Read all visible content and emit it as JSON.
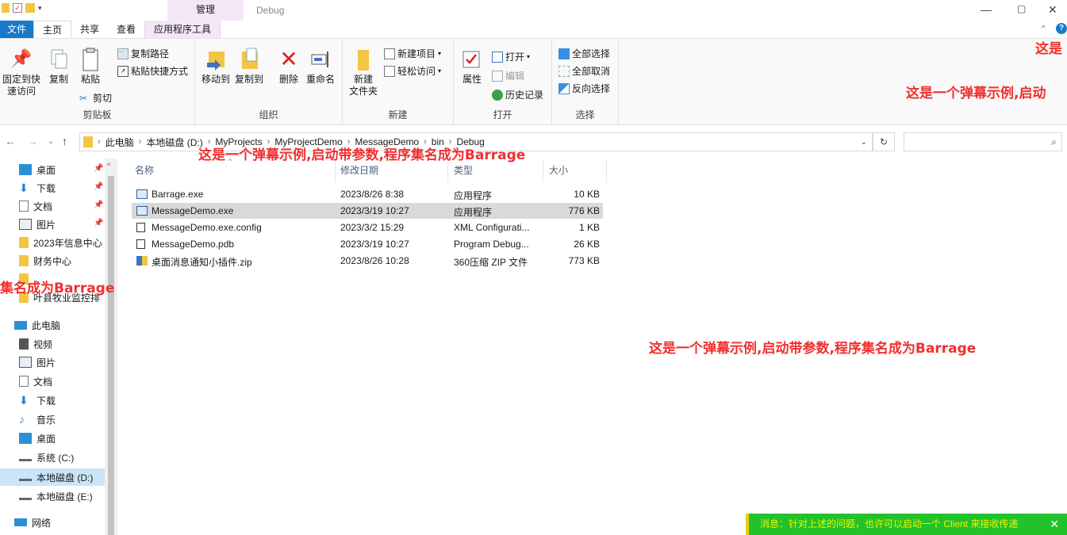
{
  "titlebar": {
    "context_tab": "管理",
    "title": "Debug",
    "min": "—",
    "restore": "▢",
    "close": "✕"
  },
  "tabs": [
    "文件",
    "主页",
    "共享",
    "查看",
    "应用程序工具"
  ],
  "ribbon": {
    "clipboard": {
      "pin_quick": "固定到快\n速访问",
      "copy": "复制",
      "paste": "粘贴",
      "copy_path": "复制路径",
      "paste_shortcut": "粘贴快捷方式",
      "cut": "剪切",
      "label": "剪贴板"
    },
    "organize": {
      "move_to": "移动到",
      "copy_to": "复制到",
      "delete": "删除",
      "rename": "重命名",
      "label": "组织"
    },
    "new": {
      "new_folder": "新建\n文件夹",
      "new_item": "新建项目",
      "easy_access": "轻松访问",
      "label": "新建"
    },
    "open": {
      "properties": "属性",
      "open": "打开",
      "edit": "编辑",
      "history": "历史记录",
      "label": "打开"
    },
    "select": {
      "select_all": "全部选择",
      "select_none": "全部取消",
      "invert": "反向选择",
      "label": "选择"
    }
  },
  "address": {
    "crumbs": [
      "此电脑",
      "本地磁盘 (D:)",
      "MyProjects",
      "MyProjectDemo",
      "MessageDemo",
      "bin",
      "Debug"
    ]
  },
  "sidebar": {
    "quick": [
      "桌面",
      "下载",
      "文档",
      "图片",
      "2023年信息中心",
      "财务中心",
      "",
      "叶县牧业监控排"
    ],
    "this_pc": "此电脑",
    "pc_items": [
      "视频",
      "图片",
      "文档",
      "下载",
      "音乐",
      "桌面",
      "系统 (C:)",
      "本地磁盘 (D:)",
      "本地磁盘 (E:)"
    ],
    "network": "网络"
  },
  "columns": {
    "name": "名称",
    "date": "修改日期",
    "type": "类型",
    "size": "大小"
  },
  "files": [
    {
      "name": "Barrage.exe",
      "date": "2023/8/26 8:38",
      "type": "应用程序",
      "size": "10 KB"
    },
    {
      "name": "MessageDemo.exe",
      "date": "2023/3/19 10:27",
      "type": "应用程序",
      "size": "776 KB"
    },
    {
      "name": "MessageDemo.exe.config",
      "date": "2023/3/2 15:29",
      "type": "XML Configurati...",
      "size": "1 KB"
    },
    {
      "name": "MessageDemo.pdb",
      "date": "2023/3/19 10:27",
      "type": "Program Debug...",
      "size": "26 KB"
    },
    {
      "name": "桌面消息通知小插件.zip",
      "date": "2023/8/26 10:28",
      "type": "360压缩 ZIP 文件",
      "size": "773 KB"
    }
  ],
  "barrage": {
    "b1": "这是",
    "b2": "这是一个弹幕示例,启动",
    "b3": "这是一个弹幕示例,启动带参数,程序集名成为Barrage",
    "b4": "集名成为Barrage",
    "b5": "这是一个弹幕示例,启动带参数,程序集名成为Barrage"
  },
  "message": {
    "text": "消息：针对上述的问题，也许可以启动一个 Client 来接收传递",
    "close": "✕"
  },
  "colors": {
    "accent": "#1979ca",
    "context_tab": "#f3e7f7",
    "barrage": "#f03030",
    "message_bg": "#22c22a",
    "message_text": "#f2f200"
  }
}
